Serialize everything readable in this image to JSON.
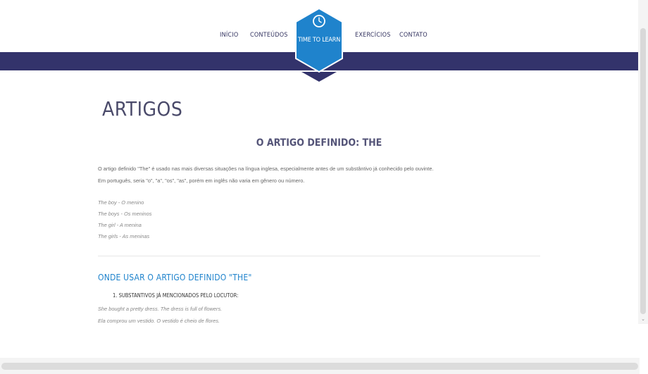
{
  "nav": {
    "items": [
      "INÍCIO",
      "CONTEÚDOS",
      "EXERCÍCIOS",
      "CONTATO"
    ],
    "logo_label": "TIME TO LEARN"
  },
  "colors": {
    "band": "#33336b",
    "hex": "#1f83cc",
    "subhead": "#1f83cc"
  },
  "icons": {
    "logo": "clock-icon",
    "scroll_down": "chevron-down-icon"
  },
  "content": {
    "page_title": "ARTIGOS",
    "section_title": "O ARTIGO DEFINIDO: THE",
    "paragraph_lines": [
      "O artigo definido \"The\" é usado nas mais diversas situações na língua inglesa, especialmente antes de um substântivo já conhecido pelo ouvinte.",
      "Em português, seria \"o\", \"a\", \"os\", \"as\", porém em inglês não varia em gênero ou número."
    ],
    "examples": [
      "The boy - O menino",
      "The boys - Os meninos",
      "The girl - A menina",
      "The girls - As meninas"
    ],
    "subheading": "ONDE USAR O ARTIGO DEFINIDO \"THE\"",
    "rule_1": "1. SUBSTANTIVOS JÁ MENCIONADOS PELO LOCUTOR:",
    "rule_examples": [
      "She bought a pretty dress. The dress is full of flowers.",
      "Ela comprou um vestido. O vestido é cheio de flores."
    ]
  }
}
